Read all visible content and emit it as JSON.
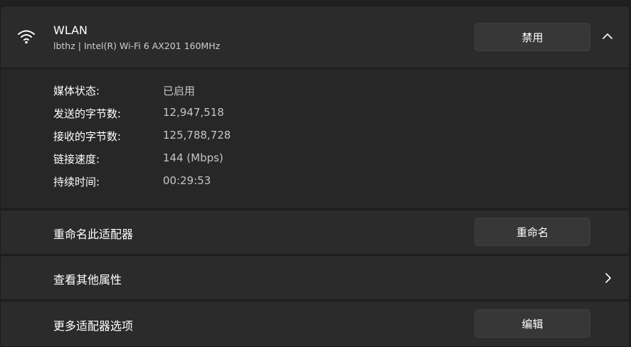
{
  "adapter": {
    "title": "WLAN",
    "subtitle": "lbthz | Intel(R) Wi-Fi 6 AX201 160MHz",
    "disable_label": "禁用",
    "icon": "wifi-icon",
    "expand_icon": "chevron-up-icon"
  },
  "properties": [
    {
      "label": "媒体状态:",
      "value": "已启用"
    },
    {
      "label": "发送的字节数:",
      "value": "12,947,518"
    },
    {
      "label": "接收的字节数:",
      "value": "125,788,728"
    },
    {
      "label": "链接速度:",
      "value": "144 (Mbps)"
    },
    {
      "label": "持续时间:",
      "value": "00:29:53"
    }
  ],
  "rename": {
    "label": "重命名此适配器",
    "button": "重命名"
  },
  "more_properties": {
    "label": "查看其他属性",
    "icon": "chevron-right-icon"
  },
  "more_options": {
    "label": "更多适配器选项",
    "button": "编辑"
  }
}
